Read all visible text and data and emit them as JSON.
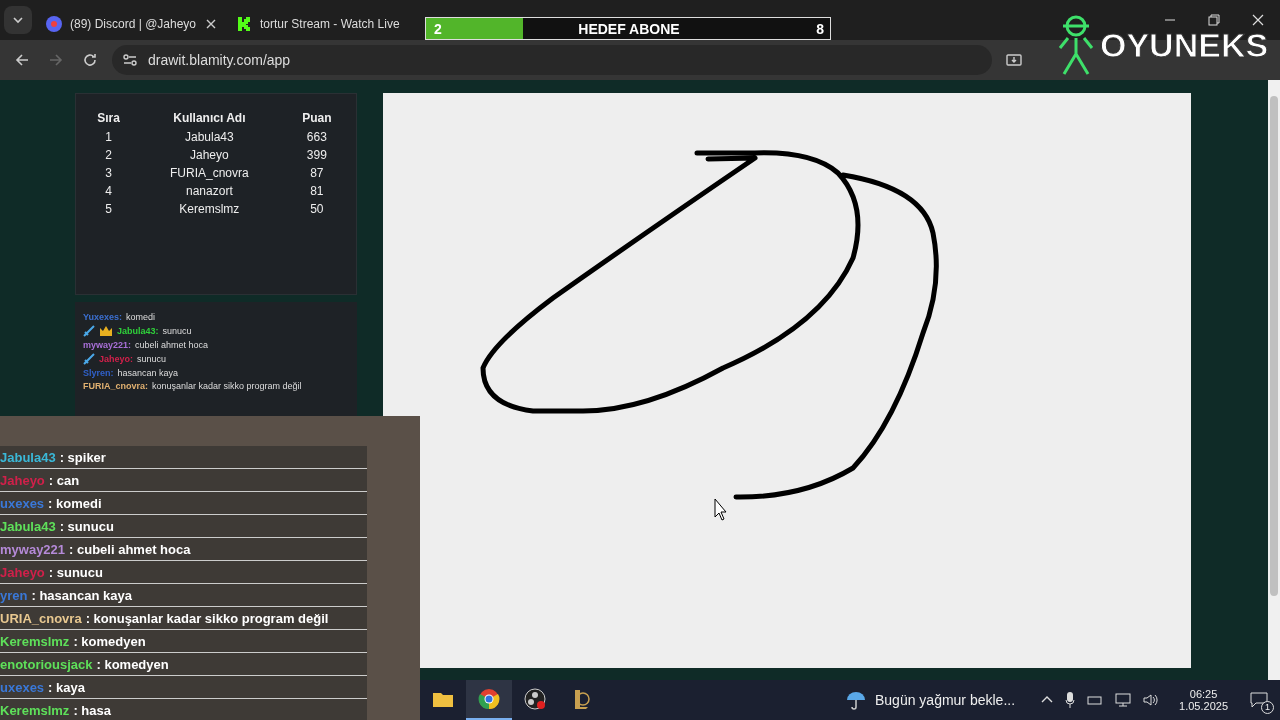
{
  "browser": {
    "tabs": [
      {
        "kind": "discord",
        "title": "(89) Discord | @Jaheyo",
        "selected": false,
        "close_button": true
      },
      {
        "kind": "kick",
        "title": "tortur Stream - Watch Live",
        "selected": false,
        "close_button": false
      }
    ],
    "address": "drawit.blamity.com/app"
  },
  "leaderboard": {
    "columns": [
      "Sıra",
      "Kullanıcı Adı",
      "Puan"
    ],
    "rows": [
      [
        "1",
        "Jabula43",
        "663"
      ],
      [
        "2",
        "Jaheyo",
        "399"
      ],
      [
        "3",
        "FURIA_cnovra",
        "87"
      ],
      [
        "4",
        "nanazort",
        "81"
      ],
      [
        "5",
        "Keremslmz",
        "50"
      ]
    ]
  },
  "chat": [
    {
      "name": "Yuxexes:",
      "color": "#3b6fd0",
      "text": "komedi"
    },
    {
      "name": "Jabula43:",
      "color": "#2fcf3a",
      "sword": true,
      "crown": true,
      "text": "sunucu"
    },
    {
      "name": "myway221:",
      "color": "#a86fd8",
      "text": "cubeli ahmet hoca"
    },
    {
      "name": "Jaheyo:",
      "color": "#d0204a",
      "sword": true,
      "text": "sunucu"
    },
    {
      "name": "Slyren:",
      "color": "#3060c8",
      "text": "hasancan kaya"
    },
    {
      "name": "FURIA_cnovra:",
      "color": "#e0b070",
      "text": "konuşanlar kadar sikko program değil"
    }
  ],
  "stream_overlay": {
    "goal": {
      "current": "2",
      "label": "HEDEF ABONE",
      "target": "8",
      "level": 0.24
    },
    "logo": "OYUNEKS",
    "chat": [
      {
        "name": "Jabula43",
        "color": "#3ab8d8",
        "text": ": spiker"
      },
      {
        "name": "Jaheyo",
        "color": "#d0204a",
        "text": ": can"
      },
      {
        "name": "uxexes",
        "color": "#3a78d8",
        "text": ": komedi"
      },
      {
        "name": "Jabula43",
        "color": "#5ee05a",
        "text": ": sunucu"
      },
      {
        "name": "myway221",
        "color": "#b58ad8",
        "text": ": cubeli ahmet hoca"
      },
      {
        "name": "Jaheyo",
        "color": "#d0204a",
        "text": ": sunucu"
      },
      {
        "name": "yren",
        "color": "#3a78d8",
        "text": ": hasancan kaya"
      },
      {
        "name": "URIA_cnovra",
        "color": "#e8c890",
        "text": ": konuşanlar kadar sikko program değil"
      },
      {
        "name": "Keremslmz",
        "color": "#5ee05a",
        "text": ": komedyen"
      },
      {
        "name": "enotoriousjack",
        "color": "#5ee05a",
        "text": ": komedyen"
      },
      {
        "name": "uxexes",
        "color": "#3a78d8",
        "text": ": kaya"
      },
      {
        "name": "Keremslmz",
        "color": "#5ee05a",
        "text": ": hasa"
      }
    ]
  },
  "taskbar": {
    "apps": [
      {
        "kind": "folder",
        "selected": false
      },
      {
        "kind": "chrome",
        "selected": true
      },
      {
        "kind": "obs",
        "selected": false
      },
      {
        "kind": "league",
        "selected": false
      }
    ],
    "weather": "Bugün yağmur bekle...",
    "time": "06:25",
    "date": "1.05.2025",
    "notifications": "1"
  }
}
